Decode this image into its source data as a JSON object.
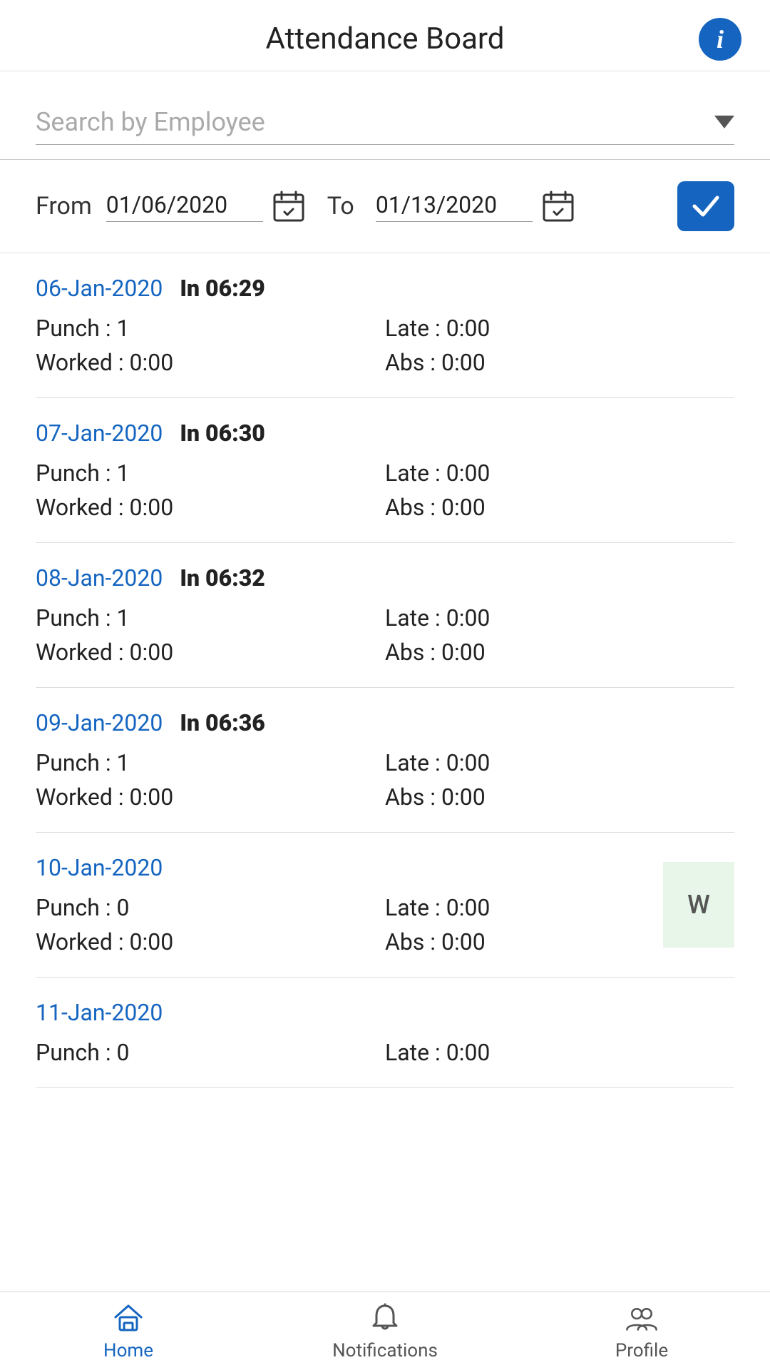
{
  "header": {
    "title": "Attendance Board",
    "info_icon": "info-icon"
  },
  "search": {
    "placeholder": "Search by Employee"
  },
  "date_range": {
    "from_label": "From",
    "from_value": "01/06/2020",
    "to_label": "To",
    "to_value": "01/13/2020",
    "confirm_label": "✓"
  },
  "records": [
    {
      "date": "06-Jan-2020",
      "in_time": "In 06:29",
      "punch": "Punch : 1",
      "late": "Late : 0:00",
      "worked": "Worked : 0:00",
      "abs": "Abs : 0:00",
      "badge": null
    },
    {
      "date": "07-Jan-2020",
      "in_time": "In 06:30",
      "punch": "Punch : 1",
      "late": "Late : 0:00",
      "worked": "Worked : 0:00",
      "abs": "Abs : 0:00",
      "badge": null
    },
    {
      "date": "08-Jan-2020",
      "in_time": "In 06:32",
      "punch": "Punch : 1",
      "late": "Late : 0:00",
      "worked": "Worked : 0:00",
      "abs": "Abs : 0:00",
      "badge": null
    },
    {
      "date": "09-Jan-2020",
      "in_time": "In 06:36",
      "punch": "Punch : 1",
      "late": "Late : 0:00",
      "worked": "Worked : 0:00",
      "abs": "Abs : 0:00",
      "badge": null
    },
    {
      "date": "10-Jan-2020",
      "in_time": "",
      "punch": "Punch : 0",
      "late": "Late : 0:00",
      "worked": "Worked : 0:00",
      "abs": "Abs : 0:00",
      "badge": "W"
    },
    {
      "date": "11-Jan-2020",
      "in_time": "",
      "punch": "Punch : 0",
      "late": "Late : 0:00",
      "worked": null,
      "abs": null,
      "badge": null,
      "partial": true
    }
  ],
  "nav": {
    "items": [
      {
        "label": "Home",
        "icon": "home-icon",
        "active": true
      },
      {
        "label": "Notifications",
        "icon": "bell-icon",
        "active": false
      },
      {
        "label": "Profile",
        "icon": "profile-icon",
        "active": false
      }
    ]
  }
}
